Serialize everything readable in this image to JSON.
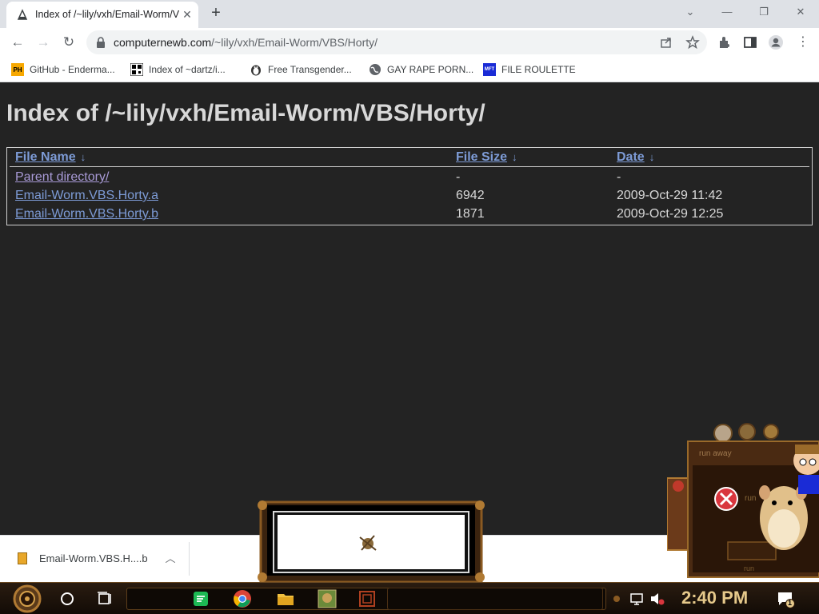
{
  "browser": {
    "tab_title": "Index of /~lily/vxh/Email-Worm/VBS/Horty/",
    "url_host": "computernewb.com",
    "url_path": "/~lily/vxh/Email-Worm/VBS/Horty/",
    "bookmarks": [
      {
        "label": "GitHub - Enderma...",
        "icon": "ph-icon"
      },
      {
        "label": "Index of ~dartz/i...",
        "icon": "qr-icon"
      },
      {
        "label": "Free Transgender...",
        "icon": "tux-icon"
      },
      {
        "label": "GAY RAPE PORN...",
        "icon": "globe-icon"
      },
      {
        "label": "FILE ROULETTE",
        "icon": "mft-icon"
      }
    ]
  },
  "page": {
    "heading": "Index of /~lily/vxh/Email-Worm/VBS/Horty/",
    "columns": {
      "name": "File Name",
      "size": "File Size",
      "date": "Date",
      "sort_arrow": "↓"
    },
    "rows": [
      {
        "name": "Parent directory/",
        "size": "-",
        "date": "-"
      },
      {
        "name": "Email-Worm.VBS.Horty.a",
        "size": "6942",
        "date": "2009-Oct-29 11:42"
      },
      {
        "name": "Email-Worm.VBS.Horty.b",
        "size": "1871",
        "date": "2009-Oct-29 12:25"
      }
    ]
  },
  "downloads": {
    "item_name": "Email-Worm.VBS.H....b"
  },
  "popup": {
    "title": "run away",
    "message": "run",
    "button": "run"
  },
  "taskbar": {
    "clock": "2:40 PM",
    "notification_count": "1"
  },
  "colors": {
    "page_bg": "#232323",
    "link": "#7d9bd6",
    "text": "#d8d8d8",
    "taskbar_brass": "#e6c98b"
  }
}
